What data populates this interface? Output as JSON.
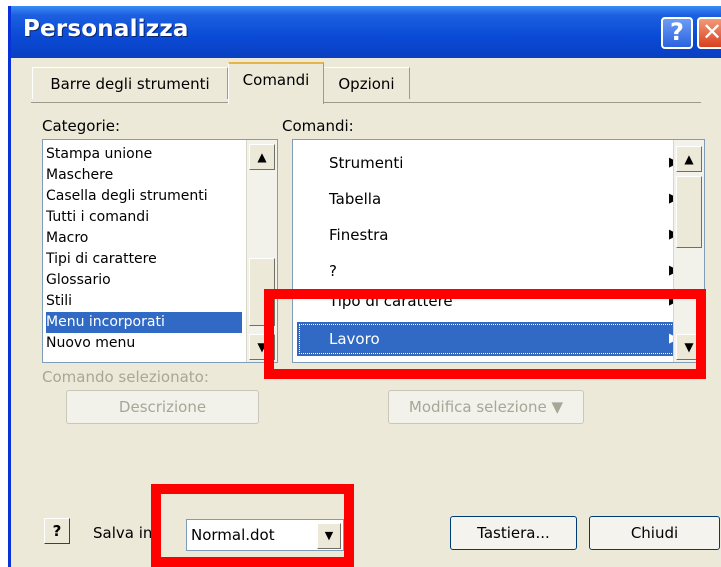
{
  "window": {
    "title": "Personalizza",
    "help_glyph": "?",
    "close_glyph": "✕"
  },
  "tabs": [
    {
      "label": "Barre degli strumenti"
    },
    {
      "label": "Comandi",
      "selected": true
    },
    {
      "label": "Opzioni"
    }
  ],
  "categories": {
    "label": "Categorie:",
    "items": [
      "Stampa unione",
      "Maschere",
      "Casella degli strumenti",
      "Tutti i comandi",
      "Macro",
      "Tipi di carattere",
      "Glossario",
      "Stili",
      "Menu incorporati",
      "Nuovo menu"
    ],
    "selected_index": 8
  },
  "commands": {
    "label": "Comandi:",
    "items": [
      "Strumenti",
      "Tabella",
      "Finestra",
      "?",
      "Tipo di carattere",
      "Lavoro"
    ],
    "selected": "Lavoro",
    "arrow_glyph": "▶"
  },
  "selected_command": {
    "label": "Comando selezionato:",
    "description_button": "Descrizione",
    "modify_button": "Modifica selezione ▼"
  },
  "footer": {
    "help_glyph": "?",
    "save_in_label": "Salva in:",
    "save_in_value": "Normal.dot",
    "keyboard_button": "Tastiera...",
    "close_button": "Chiudi"
  },
  "scroll": {
    "up_glyph": "▲",
    "down_glyph": "▼"
  },
  "colors": {
    "title_bar": "#0a4ad6",
    "selection": "#316ac5",
    "highlight_box": "#ff0000"
  }
}
